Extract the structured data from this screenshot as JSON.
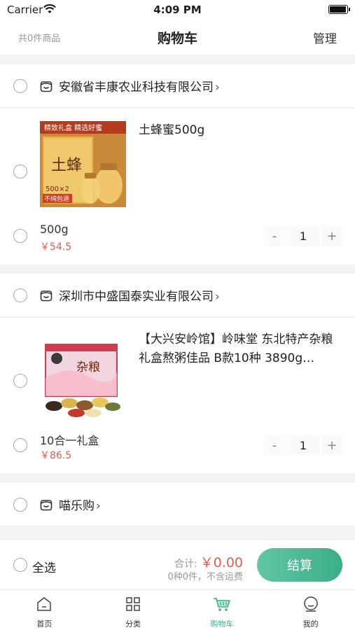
{
  "status_bar": {
    "carrier": "Carrier",
    "time": "4:09 PM"
  },
  "nav": {
    "count": "共0件商品",
    "title": "购物车",
    "manage": "管理"
  },
  "shops": [
    {
      "name": "安徽省丰康农业科技有限公司",
      "product": {
        "title": "土蜂蜜500g",
        "variant": "500g",
        "price": "￥54.5",
        "qty": "1",
        "image_icon": "honey-gift-box-image",
        "image_texts": {
          "badge": "精致礼盒 精选好蜜",
          "big": "土蜂",
          "weight": "500×2",
          "tag": "不纯包退"
        }
      }
    },
    {
      "name": "深圳市中盛国泰实业有限公司",
      "product": {
        "title": "【大兴安岭馆】岭味堂 东北特产杂粮礼盒熬粥佳品 B款10种 3890g…",
        "variant": "10合一礼盒",
        "price": "￥86.5",
        "qty": "1",
        "image_icon": "grain-gift-box-image",
        "image_texts": {
          "big": "杂粮"
        }
      }
    },
    {
      "name": "喵乐购"
    }
  ],
  "stepper": {
    "minus": "-",
    "plus": "+"
  },
  "bottom": {
    "select_all": "全选",
    "total_label": "合计:",
    "total_amount": "￥0.00",
    "shipping": "0种0件，不含运费",
    "checkout": "结算"
  },
  "tabs": [
    {
      "label": "首页",
      "icon": "home-icon"
    },
    {
      "label": "分类",
      "icon": "category-grid-icon"
    },
    {
      "label": "购物车",
      "icon": "cart-icon",
      "active": true
    },
    {
      "label": "我的",
      "icon": "profile-icon"
    }
  ],
  "colors": {
    "accent": "#3aaf86",
    "price": "#e85a4f",
    "background": "#f3f3f3"
  }
}
